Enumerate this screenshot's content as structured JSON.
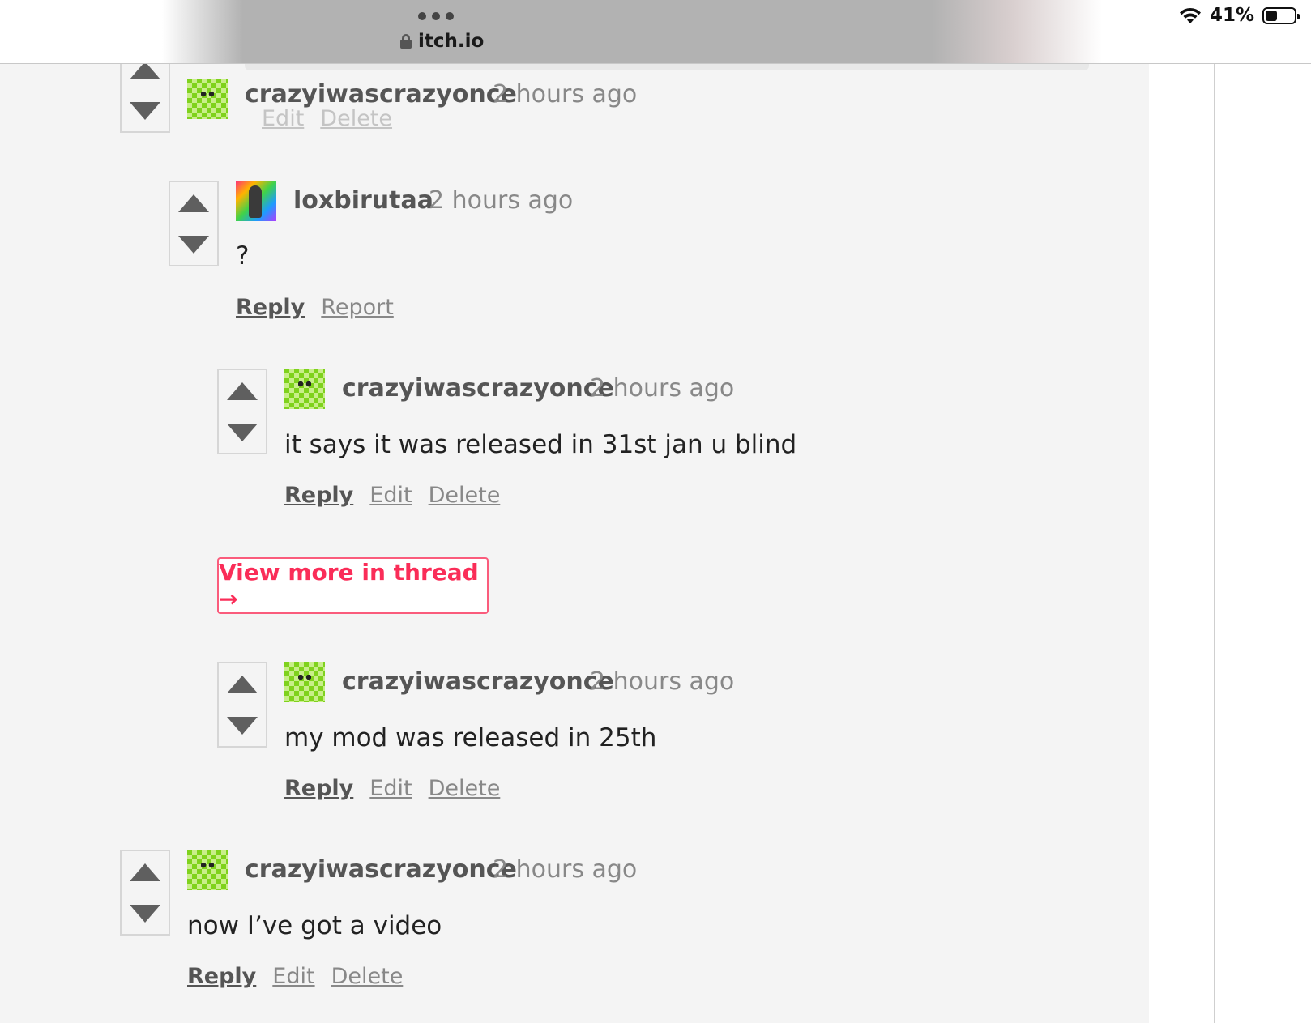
{
  "browser": {
    "url": "itch.io",
    "battery_percent": "41%",
    "battery_level": 0.41,
    "icons": [
      "ellipsis-icon",
      "lock-icon",
      "wifi-icon",
      "battery-icon"
    ]
  },
  "colors": {
    "page_bg": "#f4f4f4",
    "accent": "#fa2d58",
    "vote_arrow": "#5f5f5f",
    "username": "#555555",
    "timestamp": "#888888"
  },
  "partial_top": {
    "author": "crazyiwascrazyonce",
    "time": "2 hours ago",
    "ghost_actions": [
      "Edit",
      "Delete"
    ]
  },
  "comments": [
    {
      "author": "loxbirutaa",
      "time": "2 hours ago",
      "body": "?",
      "actions": [
        "Reply",
        "Report"
      ]
    },
    {
      "author": "crazyiwascrazyonce",
      "time": "2 hours ago",
      "body": "it says it was released in 31st jan u blind",
      "actions": [
        "Reply",
        "Edit",
        "Delete"
      ]
    },
    {
      "author": "crazyiwascrazyonce",
      "time": "2 hours ago",
      "body": "my mod was released in 25th",
      "actions": [
        "Reply",
        "Edit",
        "Delete"
      ]
    },
    {
      "author": "crazyiwascrazyonce",
      "time": "2 hours ago",
      "body": "now I’ve got a video",
      "actions": [
        "Reply",
        "Edit",
        "Delete"
      ]
    }
  ],
  "thread_button": {
    "label": "View more in thread →"
  }
}
